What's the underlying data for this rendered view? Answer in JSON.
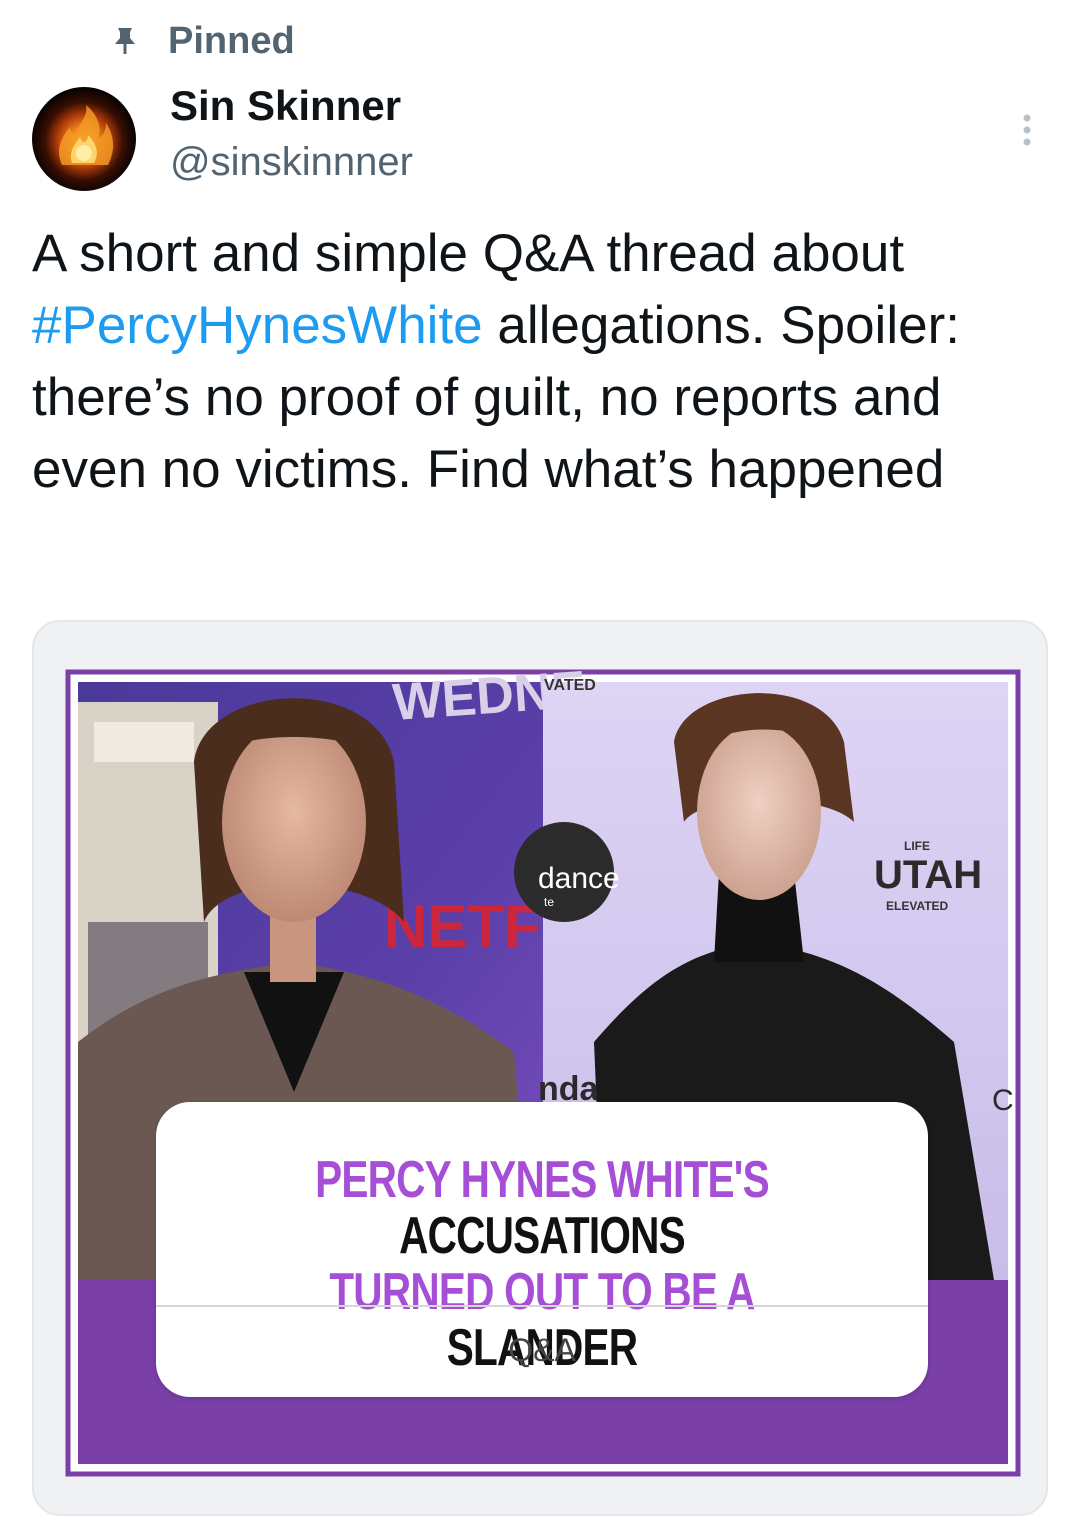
{
  "pinned": {
    "label": "Pinned",
    "icon": "pin-icon"
  },
  "author": {
    "name": "Sin Skinner",
    "handle": "@sinskinnner",
    "avatar": "fire-avatar"
  },
  "more_icon": "more-vertical-icon",
  "tweet": {
    "text_before": "A short and simple Q&A thread about ",
    "hashtag": "#PercyHynesWhite",
    "text_after": " allegations. Spoiler: there’s no proof of guilt, no reports and even no victims. Find what’s happened",
    "hashtag_color": "#1d9bf0"
  },
  "media": {
    "background_texts": {
      "wednesday": "WEDNE",
      "netflix": "NETF",
      "vated": "VATED",
      "sundance": "dance",
      "sundance_sub": "te",
      "sundance_bottom": "nda",
      "utah_life": "LIFE",
      "utah": "UTAH",
      "utah_elevated": "ELEVATED",
      "c": "C"
    },
    "headline": {
      "part1": "PERCY HYNES WHITE'S ",
      "part2": "ACCUSATIONS",
      "part3": "TURNED OUT TO BE A ",
      "part4": "SLANDER"
    },
    "qa_label": "Q&A",
    "colors": {
      "frame_purple": "#7b3fa8",
      "headline_purple": "#a64fd6"
    }
  }
}
